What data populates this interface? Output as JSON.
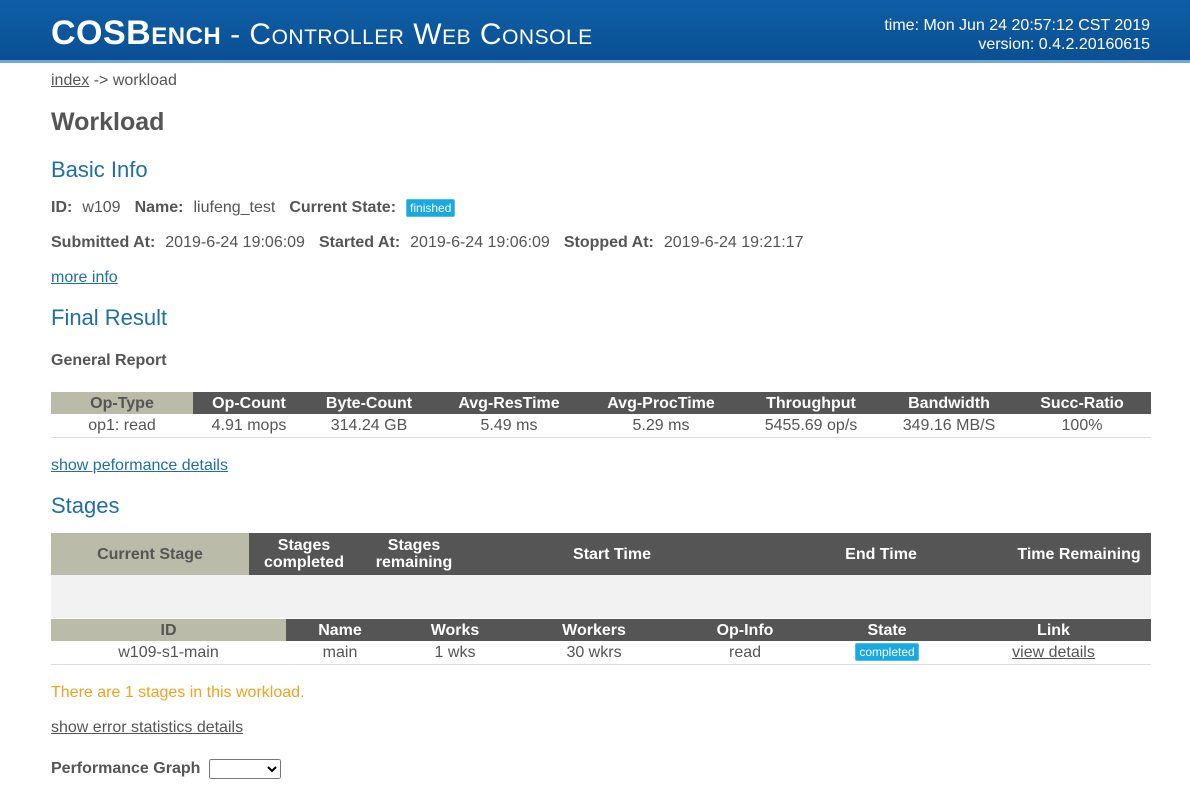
{
  "header": {
    "brand": "COSBench",
    "subtitle": " - Controller Web Console",
    "time": "time: Mon Jun 24 20:57:12 CST 2019",
    "version": "version: 0.4.2.20160615"
  },
  "breadcrumb": {
    "index": "index",
    "sep": " -> ",
    "current": "workload"
  },
  "page_title": "Workload",
  "basic_info": {
    "heading": "Basic Info",
    "id_label": "ID",
    "id": "w109",
    "name_label": "Name",
    "name": "liufeng_test",
    "state_label": "Current State",
    "state": "finished",
    "submitted_label": "Submitted At",
    "submitted": "2019-6-24 19:06:09",
    "started_label": "Started At",
    "started": "2019-6-24 19:06:09",
    "stopped_label": "Stopped At",
    "stopped": "2019-6-24 19:21:17",
    "more_info": "more info"
  },
  "final_result": {
    "heading": "Final Result",
    "report_label": "General Report",
    "columns": [
      "Op-Type",
      "Op-Count",
      "Byte-Count",
      "Avg-ResTime",
      "Avg-ProcTime",
      "Throughput",
      "Bandwidth",
      "Succ-Ratio"
    ],
    "rows": [
      [
        "op1: read",
        "4.91 mops",
        "314.24 GB",
        "5.49 ms",
        "5.29 ms",
        "5455.69 op/s",
        "349.16 MB/S",
        "100%"
      ]
    ],
    "perf_link": "show peformance details"
  },
  "stages": {
    "heading": "Stages",
    "summary_cols": [
      "Current Stage",
      "Stages completed",
      "Stages remaining",
      "Start Time",
      "End Time",
      "Time Remaining"
    ],
    "columns": [
      "ID",
      "Name",
      "Works",
      "Workers",
      "Op-Info",
      "State",
      "Link"
    ],
    "rows": [
      [
        "w109-s1-main",
        "main",
        "1 wks",
        "30 wkrs",
        "read",
        "completed",
        "view details"
      ]
    ],
    "note": "There are 1 stages in this workload.",
    "error_link": "show error statistics details"
  },
  "graph": {
    "label": "Performance Graph",
    "selected": ""
  }
}
